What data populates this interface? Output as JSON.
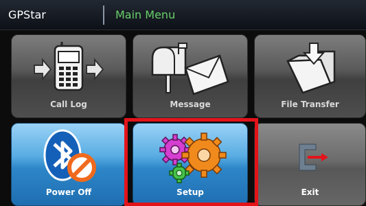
{
  "titlebar": {
    "app_name": "GPStar",
    "menu_title": "Main Menu"
  },
  "tiles": [
    {
      "label": "Call Log",
      "icon": "phone-transfer-icon"
    },
    {
      "label": "Message",
      "icon": "mailbox-envelope-icon"
    },
    {
      "label": "File Transfer",
      "icon": "folder-download-icon"
    },
    {
      "label": "Power Off",
      "icon": "bluetooth-off-icon"
    },
    {
      "label": "Setup",
      "icon": "gears-icon"
    },
    {
      "label": "Exit",
      "icon": "exit-door-icon"
    }
  ],
  "colors": {
    "highlight": "#e3131a",
    "menu_title": "#69d06a",
    "active_tile": "#2d86c8"
  }
}
